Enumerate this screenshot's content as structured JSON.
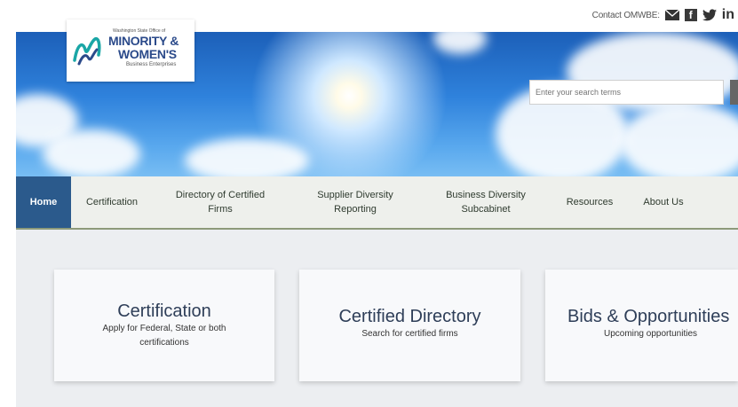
{
  "header": {
    "contact_label": "Contact OMWBE:",
    "social": [
      "envelope-icon",
      "facebook-icon",
      "twitter-icon",
      "linkedin-icon"
    ]
  },
  "logo": {
    "small_text": "Washington State Office of",
    "line1": "MINORITY &",
    "line2": "WOMEN'S",
    "line3": "Business Enterprises"
  },
  "search": {
    "placeholder": "Enter your search terms"
  },
  "nav": {
    "items": [
      {
        "label": "Home",
        "active": true
      },
      {
        "label": "Certification"
      },
      {
        "label": "Directory of Certified Firms"
      },
      {
        "label": "Supplier Diversity Reporting"
      },
      {
        "label": "Business Diversity Subcabinet"
      },
      {
        "label": "Resources"
      },
      {
        "label": "About Us"
      }
    ]
  },
  "cards": [
    {
      "title": "Certification",
      "subtitle": "Apply for Federal, State or both certifications"
    },
    {
      "title": "Certified Directory",
      "subtitle": "Search for certified firms"
    },
    {
      "title": "Bids & Opportunities",
      "subtitle": "Upcoming opportunities"
    }
  ],
  "colors": {
    "nav_active": "#2b5a8c",
    "nav_bg": "#eef0ec",
    "logo_text": "#2b4a8a",
    "card_title": "#2e3e58"
  }
}
